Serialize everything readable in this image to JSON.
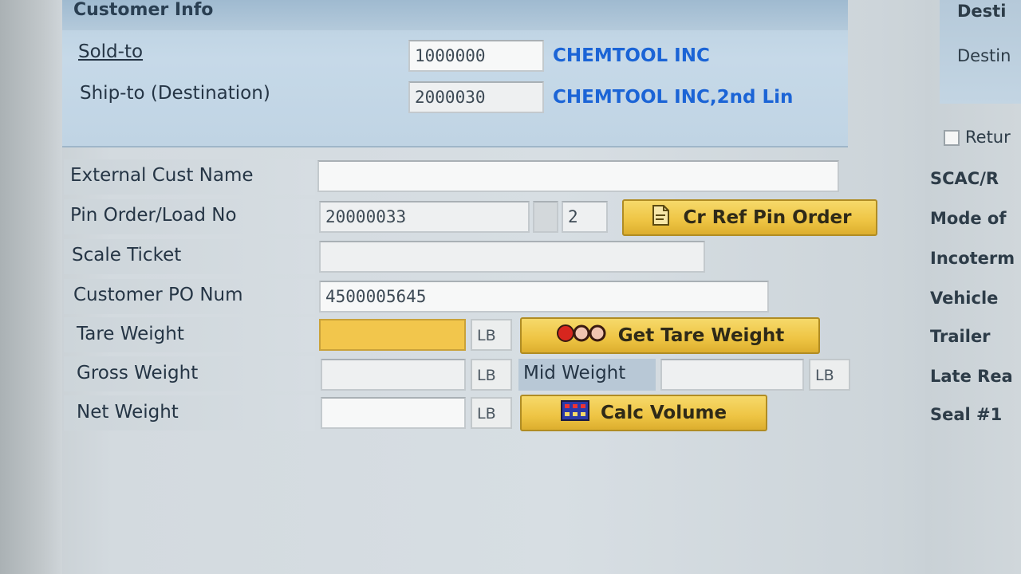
{
  "customer_info": {
    "header": "Customer Info",
    "sold_to": {
      "label": "Sold-to",
      "value": "1000000",
      "name": "CHEMTOOL INC"
    },
    "ship_to": {
      "label": "Ship-to (Destination)",
      "value": "2000030",
      "name": "CHEMTOOL INC,2nd Lin"
    }
  },
  "form": {
    "external_cust_name": {
      "label": "External Cust Name",
      "value": ""
    },
    "pin_order": {
      "label": "Pin Order/Load No",
      "value": "20000033",
      "load_no": "2",
      "button": "Cr Ref Pin Order"
    },
    "scale_ticket": {
      "label": "Scale Ticket",
      "value": ""
    },
    "customer_po": {
      "label": "Customer PO Num",
      "value": "4500005645"
    },
    "tare_weight": {
      "label": "Tare Weight",
      "value": "",
      "unit": "LB",
      "button": "Get Tare Weight"
    },
    "gross_weight": {
      "label": "Gross Weight",
      "value": "",
      "unit": "LB"
    },
    "mid_weight": {
      "label": "Mid Weight",
      "value": "",
      "unit": "LB"
    },
    "net_weight": {
      "label": "Net Weight",
      "value": "",
      "unit": "LB",
      "button": "Calc Volume"
    }
  },
  "right_panel": {
    "header": "Desti",
    "destination": "Destin",
    "return": "Retur",
    "labels": [
      "SCAC/R",
      "Mode of",
      "Incoterm",
      "Vehicle",
      "Trailer",
      "Late Rea",
      "Seal #1"
    ]
  },
  "colors": {
    "required_field": "#f2c64c",
    "link": "#1b64d6",
    "button": "#eec443"
  }
}
